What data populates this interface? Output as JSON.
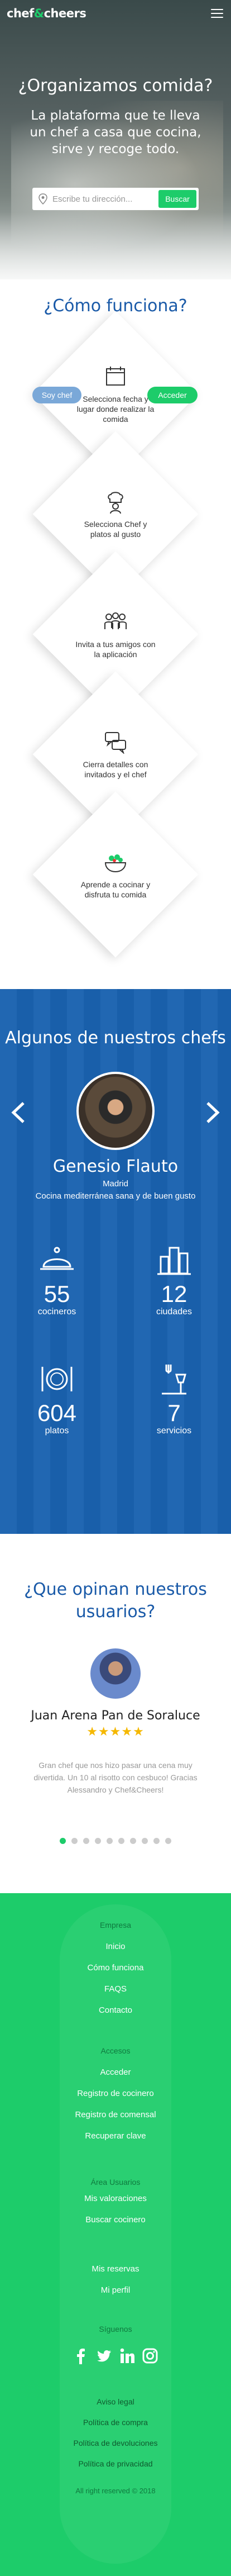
{
  "header": {
    "logo_text_1": "chef",
    "logo_amp": "&",
    "logo_text_2": "cheers"
  },
  "hero": {
    "title": "¿Organizamos comida?",
    "subtitle": "La plataforma que te lleva un chef a casa que cocina, sirve y recoge todo.",
    "search_placeholder": "Escribe tu dirección...",
    "search_button": "Buscar"
  },
  "how": {
    "title": "¿Cómo funciona?",
    "steps": [
      {
        "icon": "calendar-icon",
        "text": "Selecciona fecha y lugar donde realizar la comida"
      },
      {
        "icon": "chef-hat-icon",
        "text": "Selecciona Chef y platos al gusto"
      },
      {
        "icon": "friends-icon",
        "text": "Invita a tus amigos con la aplicación"
      },
      {
        "icon": "chat-icon",
        "text": "Cierra detalles con invitados y el chef"
      },
      {
        "icon": "food-bowl-icon",
        "text": "Aprende a cocinar y disfruta tu comida"
      }
    ],
    "pill_chef": "Soy chef",
    "pill_login": "Acceder"
  },
  "chefs": {
    "title": "Algunos de nuestros chefs",
    "name": "Genesio Flauto",
    "city": "Madrid",
    "description": "Cocina mediterránea sana y de buen gusto",
    "stats": [
      {
        "icon": "cloche-icon",
        "value": "55",
        "label": "cocineros"
      },
      {
        "icon": "city-icon",
        "value": "12",
        "label": "ciudades"
      },
      {
        "icon": "plate-icon",
        "value": "604",
        "label": "platos"
      },
      {
        "icon": "service-icon",
        "value": "7",
        "label": "servicios"
      }
    ]
  },
  "testimonials": {
    "title": "¿Que opinan nuestros usuarios?",
    "name": "Juan Arena Pan de Soraluce",
    "stars": "★★★★★",
    "rating": 5,
    "quote": "Gran chef que nos hizo pasar una cena muy divertida. Un 10 al risotto con cesbuco! Gracias Alessandro y Chef&Cheers!",
    "dots_total": 10,
    "dots_active": 1
  },
  "footer": {
    "sections": [
      {
        "head": "Empresa",
        "links": [
          "Inicio",
          "Cómo funciona",
          "FAQS",
          "Contacto"
        ]
      },
      {
        "head": "Accesos",
        "links": [
          "Acceder",
          "Registro de cocinero",
          "Registro de comensal",
          "Recuperar clave"
        ]
      },
      {
        "head": "Área Usuarios",
        "links": [
          "Mis valoraciones",
          "Buscar cocinero",
          "Mis reservas",
          "Mi perfil"
        ]
      }
    ],
    "social_head": "Síguenos",
    "social_icons": [
      "facebook-icon",
      "twitter-icon",
      "linkedin-icon",
      "instagram-icon"
    ],
    "legal": [
      "Aviso legal",
      "Política de compra",
      "Política de devoluciones",
      "Política de privacidad"
    ],
    "copyright": "All right reserved © 2018"
  },
  "colors": {
    "green": "#1dcc6a",
    "blue": "#1a62b0",
    "title_blue": "#1a5aa8",
    "star": "#f5b800"
  }
}
